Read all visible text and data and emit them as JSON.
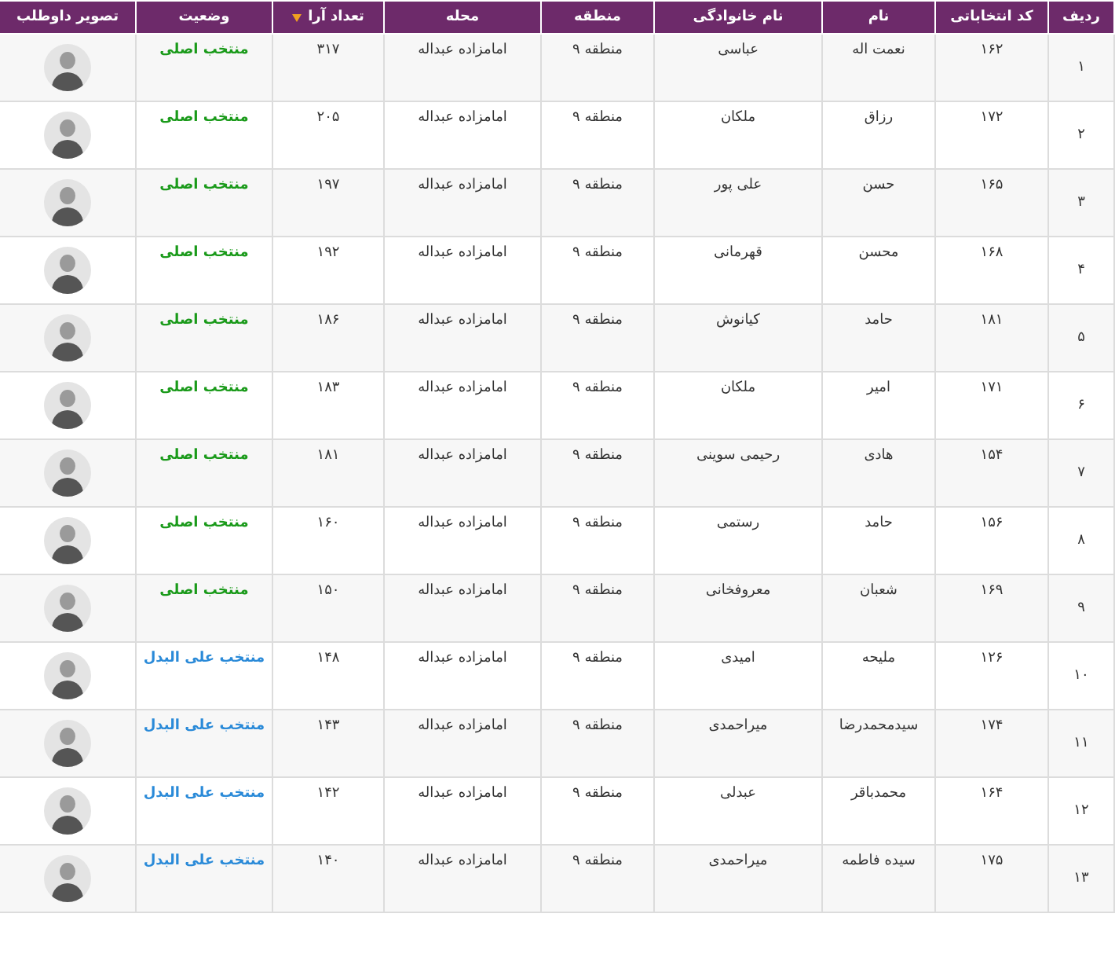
{
  "table": {
    "columns": [
      {
        "label": "ردیف",
        "sorted": false
      },
      {
        "label": "کد انتخاباتی",
        "sorted": false
      },
      {
        "label": "نام",
        "sorted": false
      },
      {
        "label": "نام خانوادگی",
        "sorted": false
      },
      {
        "label": "منطقه",
        "sorted": false
      },
      {
        "label": "محله",
        "sorted": false
      },
      {
        "label": "تعداد آرا",
        "sorted": true
      },
      {
        "label": "وضعیت",
        "sorted": false
      },
      {
        "label": "تصویر داوطلب",
        "sorted": false
      }
    ],
    "rows": [
      {
        "row": "۱",
        "code": "۱۶۲",
        "first_name": "نعمت اله",
        "last_name": "عباسی",
        "district": "منطقه ۹",
        "neighborhood": "امامزاده عبداله",
        "votes": "۳۱۷",
        "status": {
          "kind": "main",
          "text": "منتخب اصلی"
        }
      },
      {
        "row": "۲",
        "code": "۱۷۲",
        "first_name": "رزاق",
        "last_name": "ملکان",
        "district": "منطقه ۹",
        "neighborhood": "امامزاده عبداله",
        "votes": "۲۰۵",
        "status": {
          "kind": "main",
          "text": "منتخب اصلی"
        }
      },
      {
        "row": "۳",
        "code": "۱۶۵",
        "first_name": "حسن",
        "last_name": "علی پور",
        "district": "منطقه ۹",
        "neighborhood": "امامزاده عبداله",
        "votes": "۱۹۷",
        "status": {
          "kind": "main",
          "text": "منتخب اصلی"
        }
      },
      {
        "row": "۴",
        "code": "۱۶۸",
        "first_name": "محسن",
        "last_name": "قهرمانی",
        "district": "منطقه ۹",
        "neighborhood": "امامزاده عبداله",
        "votes": "۱۹۲",
        "status": {
          "kind": "main",
          "text": "منتخب اصلی"
        }
      },
      {
        "row": "۵",
        "code": "۱۸۱",
        "first_name": "حامد",
        "last_name": "کیانوش",
        "district": "منطقه ۹",
        "neighborhood": "امامزاده عبداله",
        "votes": "۱۸۶",
        "status": {
          "kind": "main",
          "text": "منتخب اصلی"
        }
      },
      {
        "row": "۶",
        "code": "۱۷۱",
        "first_name": "امیر",
        "last_name": "ملکان",
        "district": "منطقه ۹",
        "neighborhood": "امامزاده عبداله",
        "votes": "۱۸۳",
        "status": {
          "kind": "main",
          "text": "منتخب اصلی"
        }
      },
      {
        "row": "۷",
        "code": "۱۵۴",
        "first_name": "هادی",
        "last_name": "رحیمی سوینی",
        "district": "منطقه ۹",
        "neighborhood": "امامزاده عبداله",
        "votes": "۱۸۱",
        "status": {
          "kind": "main",
          "text": "منتخب اصلی"
        }
      },
      {
        "row": "۸",
        "code": "۱۵۶",
        "first_name": "حامد",
        "last_name": "رستمی",
        "district": "منطقه ۹",
        "neighborhood": "امامزاده عبداله",
        "votes": "۱۶۰",
        "status": {
          "kind": "main",
          "text": "منتخب اصلی"
        }
      },
      {
        "row": "۹",
        "code": "۱۶۹",
        "first_name": "شعبان",
        "last_name": "معروفخانی",
        "district": "منطقه ۹",
        "neighborhood": "امامزاده عبداله",
        "votes": "۱۵۰",
        "status": {
          "kind": "main",
          "text": "منتخب اصلی"
        }
      },
      {
        "row": "۱۰",
        "code": "۱۲۶",
        "first_name": "ملیحه",
        "last_name": "امیدی",
        "district": "منطقه ۹",
        "neighborhood": "امامزاده عبداله",
        "votes": "۱۴۸",
        "status": {
          "kind": "alternate",
          "text": "منتخب علی البدل"
        }
      },
      {
        "row": "۱۱",
        "code": "۱۷۴",
        "first_name": "سیدمحمدرضا",
        "last_name": "میراحمدی",
        "district": "منطقه ۹",
        "neighborhood": "امامزاده عبداله",
        "votes": "۱۴۳",
        "status": {
          "kind": "alternate",
          "text": "منتخب علی البدل"
        }
      },
      {
        "row": "۱۲",
        "code": "۱۶۴",
        "first_name": "محمدباقر",
        "last_name": "عبدلی",
        "district": "منطقه ۹",
        "neighborhood": "امامزاده عبداله",
        "votes": "۱۴۲",
        "status": {
          "kind": "alternate",
          "text": "منتخب علی البدل"
        }
      },
      {
        "row": "۱۳",
        "code": "۱۷۵",
        "first_name": "سیده فاطمه",
        "last_name": "میراحمدی",
        "district": "منطقه ۹",
        "neighborhood": "امامزاده عبداله",
        "votes": "۱۴۰",
        "status": {
          "kind": "alternate",
          "text": "منتخب علی البدل"
        }
      }
    ]
  }
}
